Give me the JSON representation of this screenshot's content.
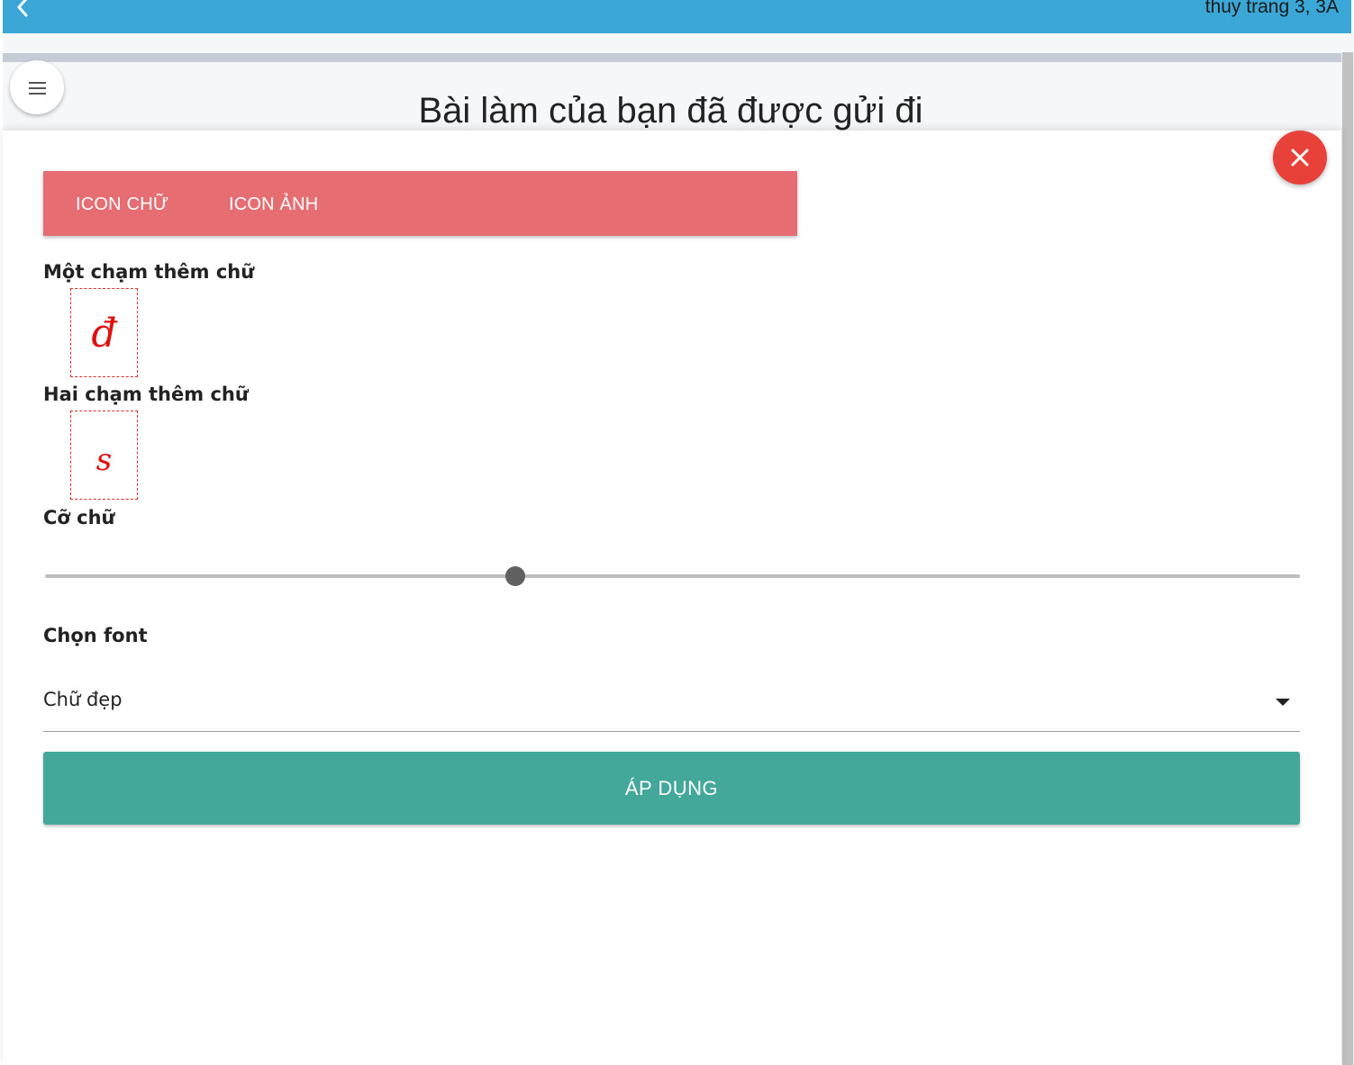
{
  "header": {
    "user_label": "thuy trang 3, 3A"
  },
  "page": {
    "title": "Bài làm của bạn đã được gửi đi"
  },
  "sheet": {
    "tabs": [
      {
        "label": "ICON CHỮ",
        "active": true
      },
      {
        "label": "ICON ẢNH",
        "active": false
      }
    ],
    "one_touch": {
      "label": "Một chạm thêm chữ",
      "glyph": "đ"
    },
    "two_touch": {
      "label": "Hai chạm thêm chữ",
      "glyph": "s"
    },
    "font_size": {
      "label": "Cỡ chữ",
      "value_fraction": 0.375
    },
    "font_select": {
      "label": "Chọn font",
      "value": "Chữ đẹp"
    },
    "apply_label": "ÁP DỤNG"
  },
  "colors": {
    "topbar": "#3ba7d6",
    "tabs_bg": "#e66d71",
    "close_button": "#e8413a",
    "apply_button": "#43a89a",
    "glyph": "#e01010"
  },
  "icons": {
    "back": "chevron-left-icon",
    "menu": "hamburger-menu-icon",
    "close": "close-icon",
    "dropdown": "caret-down-icon"
  }
}
